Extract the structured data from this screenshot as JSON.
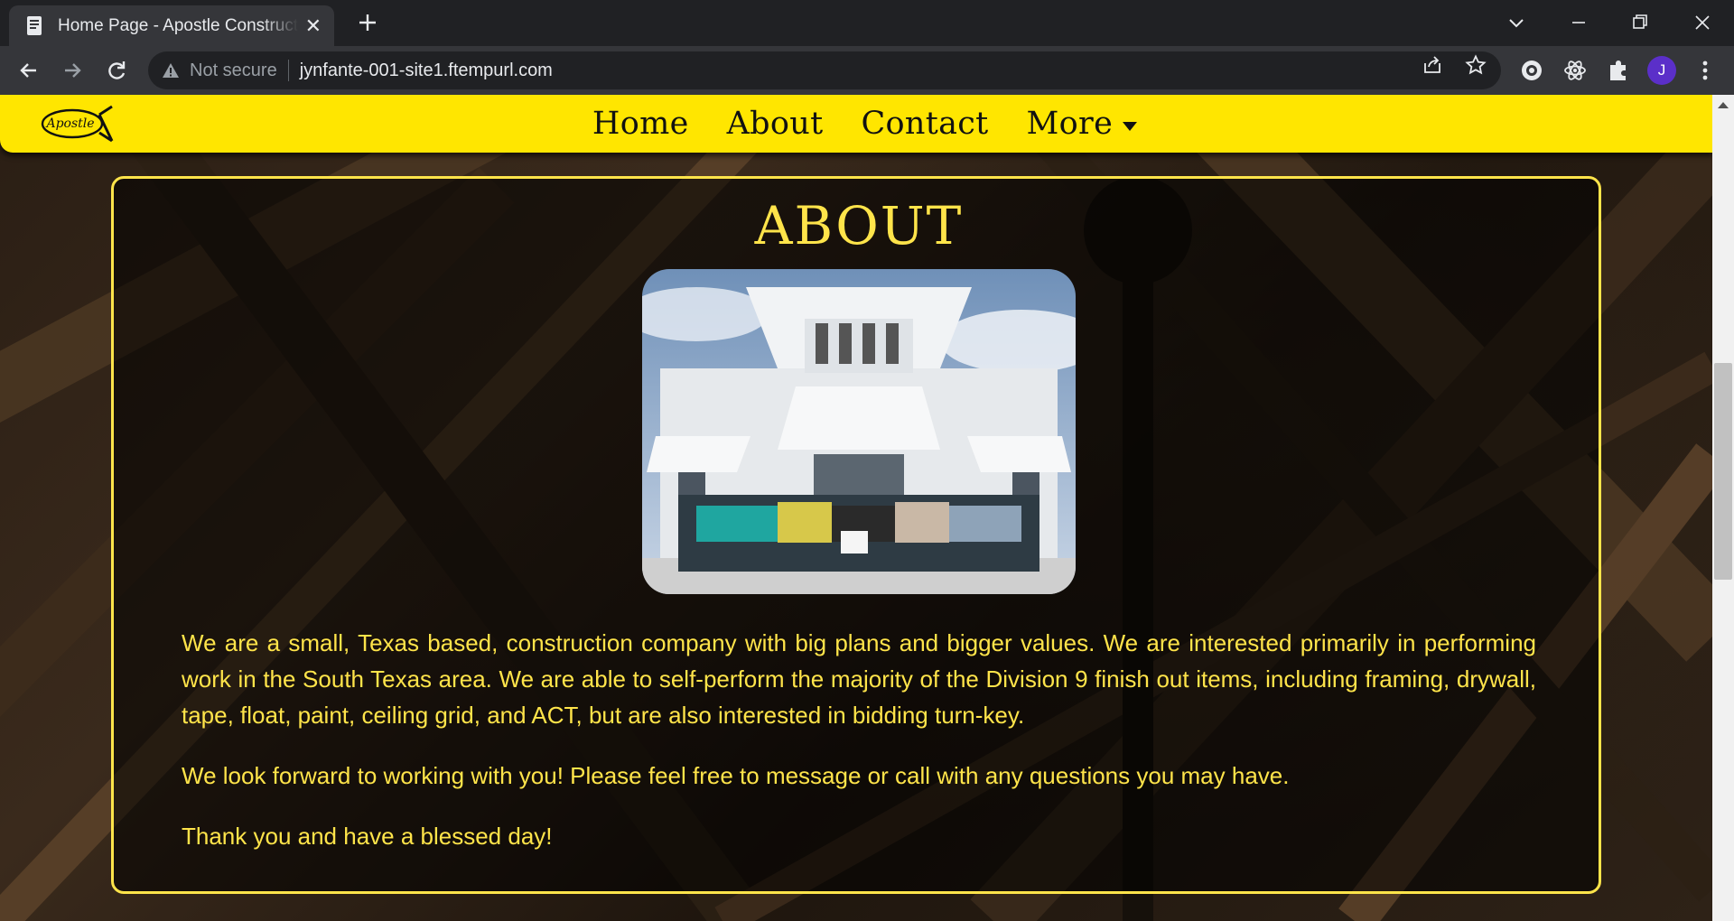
{
  "browser": {
    "tab_title": "Home Page - Apostle Construction",
    "security_label": "Not secure",
    "url": "jynfante-001-site1.ftempurl.com",
    "profile_initial": "J"
  },
  "site": {
    "logo_text": "Apostle",
    "nav": {
      "home": "Home",
      "about": "About",
      "contact": "Contact",
      "more": "More"
    },
    "about": {
      "title": "ABOUT",
      "paragraph1": "We are a small, Texas based, construction company with big plans and bigger values. We are interested primarily in performing work in the South Texas area. We are able to self-perform the majority of the Division 9 finish out items, including framing, drywall, tape, float, paint, ceiling grid, and ACT, but are also interested in bidding turn-key.",
      "paragraph2": "We look forward to working with you! Please feel free to message or call with any questions you may have.",
      "paragraph3": "Thank you and have a blessed day!"
    }
  },
  "colors": {
    "brand_yellow": "#ffe600",
    "text_yellow": "#ffe44a"
  },
  "icons": [
    "page-favicon",
    "close-icon",
    "plus-icon",
    "chevron-down-icon",
    "minimize-icon",
    "restore-icon",
    "close-window-icon",
    "back-arrow-icon",
    "forward-arrow-icon",
    "reload-icon",
    "warning-icon",
    "share-icon",
    "star-icon",
    "extension-icon",
    "react-icon",
    "puzzle-icon",
    "kebab-menu-icon",
    "caret-down-icon"
  ]
}
